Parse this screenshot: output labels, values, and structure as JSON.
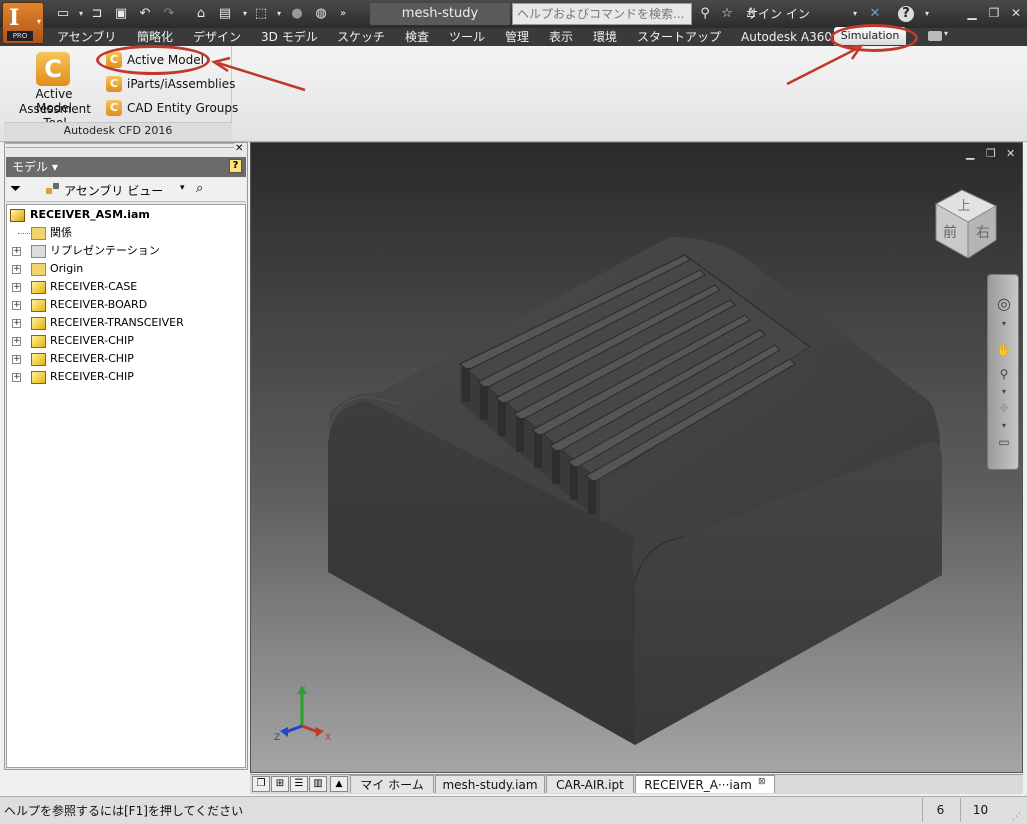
{
  "app": {
    "logo_letter": "I",
    "edition": "PRO"
  },
  "title_bar": {
    "document_title": "mesh-study",
    "search_placeholder": "ヘルプおよびコマンドを検索...",
    "sign_in": "サイン イン"
  },
  "ribbon_tabs": [
    "アセンブリ",
    "簡略化",
    "デザイン",
    "3D モデル",
    "スケッチ",
    "検査",
    "ツール",
    "管理",
    "表示",
    "環境",
    "スタートアップ",
    "Autodesk A360",
    "Simulation"
  ],
  "ribbon": {
    "big_button_line1": "Active Model",
    "big_button_line2": "Assessment Tool",
    "small_buttons": [
      "Active Model",
      "iParts/iAssemblies",
      "CAD Entity Groups"
    ],
    "panel_title": "Autodesk CFD 2016"
  },
  "browser": {
    "header": "モデル",
    "view_dropdown": "アセンブリ ビュー",
    "tree": [
      {
        "label": "RECEIVER_ASM.iam",
        "level": 0,
        "icon": "assembly-icon",
        "expander": false
      },
      {
        "label": "関係",
        "level": 1,
        "icon": "folder-icon",
        "expander": false
      },
      {
        "label": "リプレゼンテーション",
        "level": 1,
        "icon": "representation-icon",
        "expander": true
      },
      {
        "label": "Origin",
        "level": 1,
        "icon": "folder-icon",
        "expander": true
      },
      {
        "label": "RECEIVER-CASE",
        "level": 1,
        "icon": "part-icon",
        "expander": true
      },
      {
        "label": "RECEIVER-BOARD",
        "level": 1,
        "icon": "part-icon",
        "expander": true
      },
      {
        "label": "RECEIVER-TRANSCEIVER",
        "level": 1,
        "icon": "part-icon",
        "expander": true
      },
      {
        "label": "RECEIVER-CHIP",
        "level": 1,
        "icon": "part-icon",
        "expander": true
      },
      {
        "label": "RECEIVER-CHIP",
        "level": 1,
        "icon": "part-icon",
        "expander": true
      },
      {
        "label": "RECEIVER-CHIP",
        "level": 1,
        "icon": "part-icon",
        "expander": true
      }
    ]
  },
  "viewcube": {
    "top_face": "上",
    "front_face": "前",
    "right_face": "右"
  },
  "axis_triad": {
    "x": "X",
    "y": "Y",
    "z": "Z"
  },
  "doc_tabs": [
    "マイ ホーム",
    "mesh-study.iam",
    "CAR-AIR.ipt",
    "RECEIVER_A···iam"
  ],
  "status": {
    "help_text": "ヘルプを参照するには[F1]を押してください",
    "count1": "6",
    "count2": "10"
  },
  "colors": {
    "accent": "#e08e1b",
    "annotation": "#c0392b",
    "model_body": "#3c3c3c"
  }
}
